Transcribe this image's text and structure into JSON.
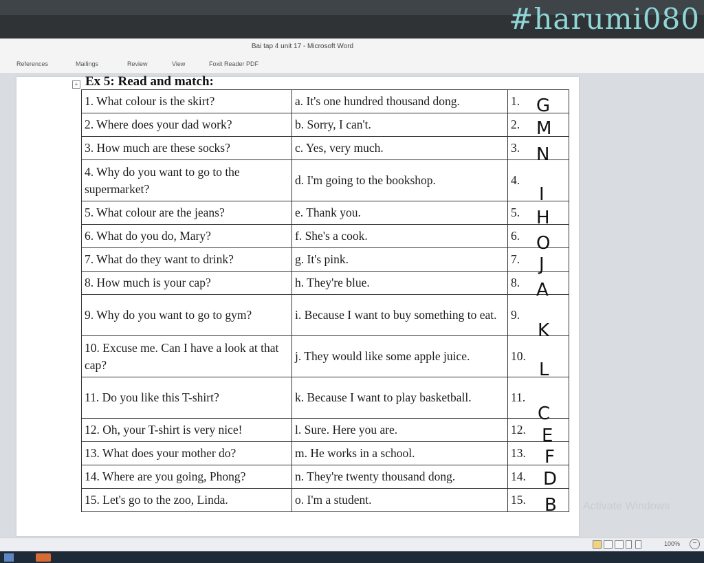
{
  "watermark": "#harumi080",
  "window_title": "Bai tap 4 unit 17 - Microsoft Word",
  "ribbon_tabs": [
    "References",
    "Mailings",
    "Review",
    "View",
    "Foxit Reader PDF"
  ],
  "exercise_title": "Ex 5: Read and match:",
  "rows": [
    {
      "q": "1. What colour is the skirt?",
      "a": "a. It's one hundred thousand dong.",
      "n": "1."
    },
    {
      "q": "2. Where does your dad work?",
      "a": "b. Sorry, I can't.",
      "n": "2."
    },
    {
      "q": "3. How much are these socks?",
      "a": "c. Yes, very much.",
      "n": "3."
    },
    {
      "q": "4. Why do you want to go to the supermarket?",
      "a": "d. I'm going to the bookshop.",
      "n": "4."
    },
    {
      "q": "5. What colour are the jeans?",
      "a": "e. Thank you.",
      "n": "5."
    },
    {
      "q": "6. What do you do, Mary?",
      "a": "f. She's a cook.",
      "n": "6."
    },
    {
      "q": "7. What do they want to drink?",
      "a": "g. It's pink.",
      "n": "7."
    },
    {
      "q": "8. How much is your cap?",
      "a": "h. They're blue.",
      "n": "8."
    },
    {
      "q": "9. Why do you want to go to gym?",
      "a": "i. Because I want to buy something to eat.",
      "n": "9."
    },
    {
      "q": "10. Excuse me. Can I have a look at that cap?",
      "a": "j. They would like some apple juice.",
      "n": "10."
    },
    {
      "q": "11. Do you like this T-shirt?",
      "a": "k. Because I want to play basketball.",
      "n": "11."
    },
    {
      "q": "12. Oh, your T-shirt is very nice!",
      "a": "l. Sure. Here you are.",
      "n": "12."
    },
    {
      "q": "13. What does your mother do?",
      "a": "m. He works in a school.",
      "n": "13."
    },
    {
      "q": "14. Where are you going, Phong?",
      "a": "n. They're twenty thousand dong.",
      "n": "14."
    },
    {
      "q": "15. Let's go to the zoo, Linda.",
      "a": "o. I'm a student.",
      "n": "15."
    }
  ],
  "handwritten_answers": [
    "G",
    "M",
    "N",
    "I",
    "H",
    "O",
    "J",
    "A",
    "K",
    "L",
    "C",
    "E",
    "F",
    "D",
    "B"
  ],
  "activate_windows": "Activate Windows",
  "zoom": "100%",
  "colors": {
    "watermark": "#8fd6d8",
    "topbar": "#2f3336",
    "taskbar": "#1f2a38"
  }
}
